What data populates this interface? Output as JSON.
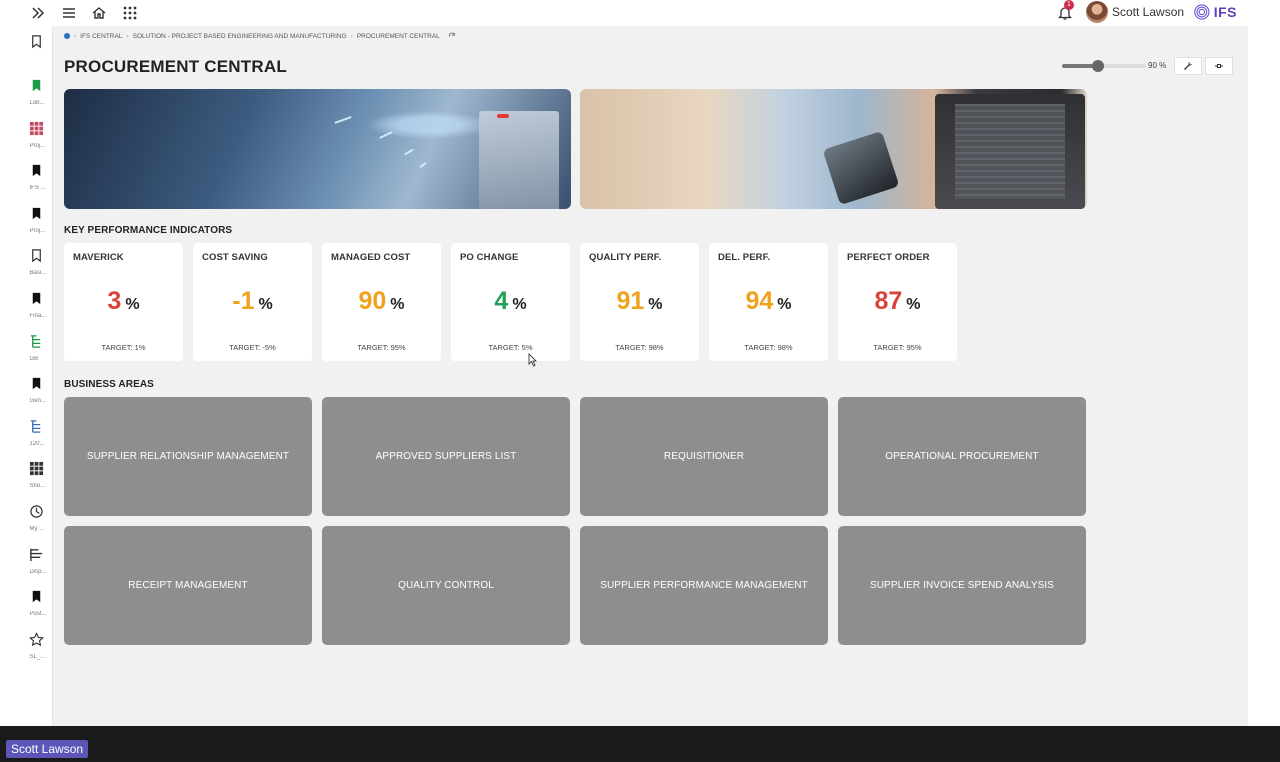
{
  "topbar": {
    "user_name": "Scott Lawson",
    "notification_count": "1",
    "logo_text": "IFS"
  },
  "leftnav": {
    "items": [
      {
        "icon": "bookmark-filled-icon",
        "label": "Lob..."
      },
      {
        "icon": "grid-icon",
        "label": "Proj..."
      },
      {
        "icon": "bookmark-filled-icon",
        "label": "IFS ..."
      },
      {
        "icon": "bookmark-filled-icon",
        "label": "Proj..."
      },
      {
        "icon": "bookmark-outline-icon",
        "label": "Basi..."
      },
      {
        "icon": "bookmark-filled-icon",
        "label": "Fina..."
      },
      {
        "icon": "tree-icon",
        "label": "GB"
      },
      {
        "icon": "bookmark-filled-icon",
        "label": "Gen..."
      },
      {
        "icon": "tree-icon",
        "label": "120..."
      },
      {
        "icon": "grid-icon",
        "label": "Sho..."
      },
      {
        "icon": "clock-icon",
        "label": "My ..."
      },
      {
        "icon": "bars-icon",
        "label": "Disp..."
      },
      {
        "icon": "bookmark-filled-icon",
        "label": "Post..."
      },
      {
        "icon": "star-icon",
        "label": "SL_..."
      }
    ]
  },
  "breadcrumb": {
    "items": [
      "IFS CENTRAL",
      "SOLUTION - PROJECT BASED ENGINEERING AND MANUFACTURING",
      "PROCUREMENT CENTRAL"
    ]
  },
  "page": {
    "title": "PROCUREMENT CENTRAL",
    "zoom_label": "90 %",
    "zoom_level": 0.43
  },
  "kpi_section_title": "KEY PERFORMANCE INDICATORS",
  "kpis": [
    {
      "title": "MAVERICK",
      "value": "3",
      "unit": "%",
      "target": "TARGET: 1%",
      "color": "#d9443a"
    },
    {
      "title": "COST SAVING",
      "value": "-1",
      "unit": "%",
      "target": "TARGET: -5%",
      "color": "#f0a21e"
    },
    {
      "title": "MANAGED COST",
      "value": "90",
      "unit": "%",
      "target": "TARGET: 95%",
      "color": "#f0a21e"
    },
    {
      "title": "PO CHANGE",
      "value": "4",
      "unit": "%",
      "target": "TARGET: 5%",
      "color": "#22a05a"
    },
    {
      "title": "QUALITY PERF.",
      "value": "91",
      "unit": "%",
      "target": "TARGET: 98%",
      "color": "#f0a21e"
    },
    {
      "title": "DEL. PERF.",
      "value": "94",
      "unit": "%",
      "target": "TARGET: 98%",
      "color": "#f0a21e"
    },
    {
      "title": "PERFECT ORDER",
      "value": "87",
      "unit": "%",
      "target": "TARGET: 95%",
      "color": "#d9443a"
    }
  ],
  "business_section_title": "BUSINESS AREAS",
  "business_areas": [
    "SUPPLIER RELATIONSHIP MANAGEMENT",
    "APPROVED SUPPLIERS LIST",
    "REQUISITIONER",
    "OPERATIONAL PROCUREMENT",
    "RECEIPT MANAGEMENT",
    "QUALITY CONTROL",
    "SUPPLIER PERFORMANCE MANAGEMENT",
    "SUPPLIER INVOICE SPEND ANALYSIS"
  ],
  "taskbar": {
    "user_label": "Scott Lawson"
  }
}
